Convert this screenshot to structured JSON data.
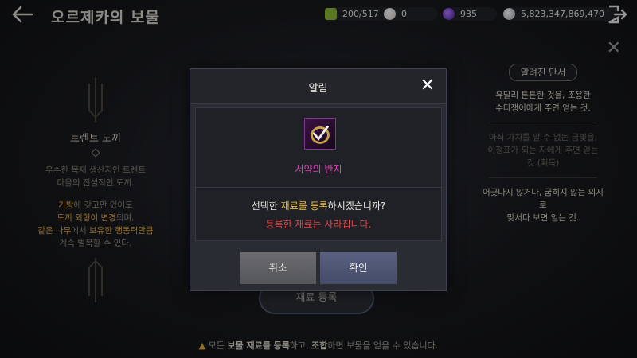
{
  "header": {
    "title": "오르제카의 보물",
    "resources": [
      {
        "icon": "bag-icon",
        "value": "200/517",
        "color": "#8fb83a"
      },
      {
        "icon": "pearl-icon",
        "value": "0",
        "color": "#e9dfe0"
      },
      {
        "icon": "purple-gem-icon",
        "value": "935",
        "color": "#7a3cd6"
      },
      {
        "icon": "silver-coin-icon",
        "value": "5,823,347,869,470",
        "color": "#cfd6e0"
      }
    ]
  },
  "left_panel": {
    "title": "트렌트 도끼",
    "desc": [
      "우수한 목재 생산지인 트렌트",
      "마을의 전설적인 도끼."
    ],
    "info_line1_a": "가방",
    "info_line1_b": "에 갖고만 있어도",
    "info_line2_a": "도끼 외형이 변경",
    "info_line2_b": "되며,",
    "info_line3_a": "같은 나무",
    "info_line3_b": "에서 ",
    "info_line3_c": "보유한 행동력만큼",
    "info_line4": "계속 벌목할 수 있다."
  },
  "right_panel": {
    "badge": "알려진 단서",
    "hints": [
      {
        "lines": [
          "유달리 튼튼한 것을, 조용한",
          "수다쟁이에게 주면 얻는 것."
        ],
        "known": true
      },
      {
        "lines": [
          "아직 가치를 알 수 없는 금빛을,",
          "이정표가 되는 자에게 주면 얻는",
          "것.(획득)"
        ],
        "known": false
      },
      {
        "lines": [
          "어긋나지 않거나, 굽히지 않는 의지로",
          "맞서다 보면 얻는 것."
        ],
        "known": true
      }
    ]
  },
  "register_button": "재료 등록",
  "footer": {
    "p1": "모든 ",
    "b1": "보물 재료를 등록",
    "p2": "하고, ",
    "b2": "조합",
    "p3": "하면 보물을 얻을 수 있습니다."
  },
  "modal": {
    "title": "알림",
    "item_name": "서약의 반지",
    "msg_p1": "선택한 ",
    "msg_hl": "재료를 등록",
    "msg_p2": "하시겠습니까?",
    "warning": "등록한 재료는 사라집니다.",
    "cancel_label": "취소",
    "ok_label": "확인"
  }
}
